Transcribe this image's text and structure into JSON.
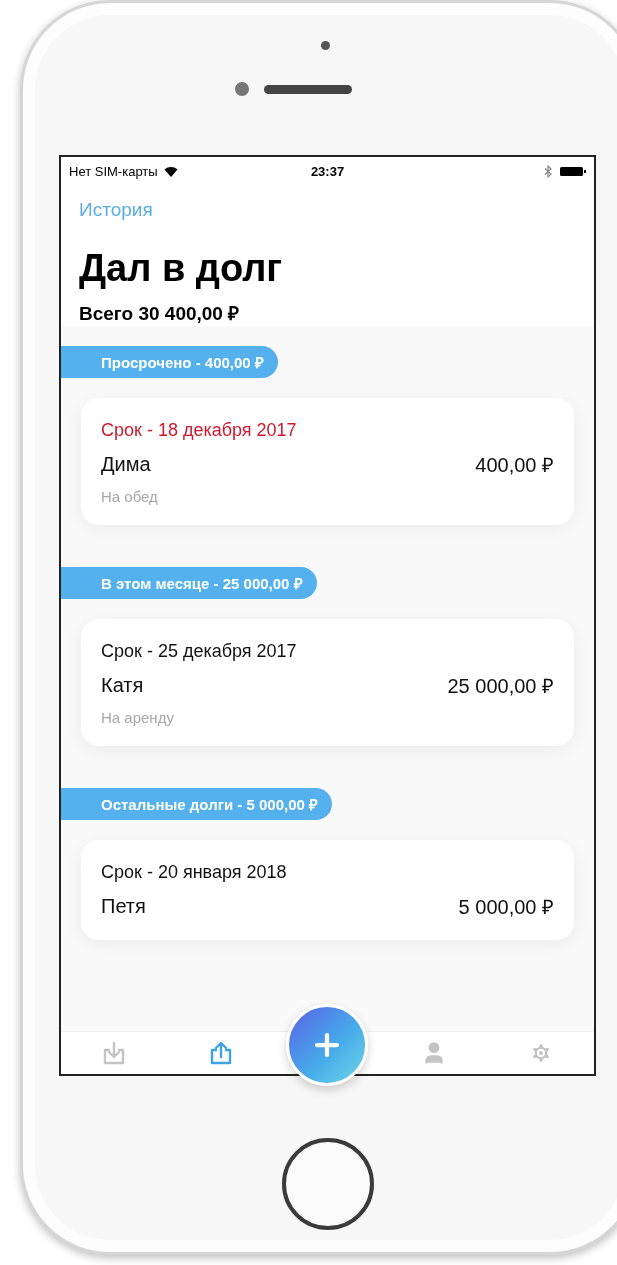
{
  "status_bar": {
    "carrier": "Нет SIM-карты",
    "time": "23:37"
  },
  "nav": {
    "back": "История"
  },
  "title": "Дал в долг",
  "total": "Всего 30 400,00 ₽",
  "sections": [
    {
      "label": "Просрочено - 400,00 ₽",
      "debts": [
        {
          "due": "Срок - 18 декабря 2017",
          "overdue": true,
          "name": "Дима",
          "amount": "400,00 ₽",
          "note": "На обед"
        }
      ]
    },
    {
      "label": "В этом месяце - 25 000,00 ₽",
      "debts": [
        {
          "due": "Срок - 25 декабря 2017",
          "overdue": false,
          "name": "Катя",
          "amount": "25 000,00 ₽",
          "note": "На аренду"
        }
      ]
    },
    {
      "label": "Остальные долги - 5 000,00 ₽",
      "debts": [
        {
          "due": "Срок - 20 января 2018",
          "overdue": false,
          "name": "Петя",
          "amount": "5 000,00 ₽"
        }
      ]
    }
  ],
  "tab_bar": [
    {
      "kind": "incoming",
      "selected": false
    },
    {
      "kind": "outgoing",
      "selected": true
    },
    {
      "kind": "add",
      "selected": false
    },
    {
      "kind": "profile",
      "selected": false
    },
    {
      "kind": "settings",
      "selected": false
    }
  ]
}
